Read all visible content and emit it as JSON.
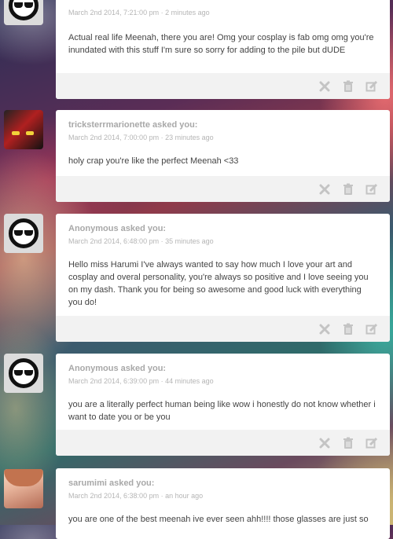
{
  "posts": [
    {
      "asker": "",
      "meta": "March 2nd 2014, 7:21:00 pm · 2 minutes ago",
      "body": "Actual real life Meenah, there you are! Omg your cosplay is fab omg omg you're inundated with this stuff I'm sure so sorry for adding to the pile but dUDE"
    },
    {
      "asker": "tricksterrmarionette asked you:",
      "meta": "March 2nd 2014, 7:00:00 pm · 23 minutes ago",
      "body": "holy crap you're like the perfect Meenah <33"
    },
    {
      "asker": "Anonymous asked you:",
      "meta": "March 2nd 2014, 6:48:00 pm · 35 minutes ago",
      "body": "Hello miss Harumi I've always wanted to say how much I love your art and cosplay and overal personality, you're always so positive and I love seeing you on my dash. Thank you for being so awesome and good luck with everything you do!"
    },
    {
      "asker": "Anonymous asked you:",
      "meta": "March 2nd 2014, 6:39:00 pm · 44 minutes ago",
      "body": "you are a literally perfect human being like wow i honestly do not know whether i want to date you or be you"
    },
    {
      "asker": "sarumimi asked you:",
      "meta": "March 2nd 2014, 6:38:00 pm · an hour ago",
      "body": "you are one of the best meenah ive ever seen ahh!!!! those glasses are just so"
    }
  ],
  "icons": {
    "delete": "close-icon",
    "trash": "trash-icon",
    "edit": "edit-icon",
    "color": "#c8c8c8"
  }
}
